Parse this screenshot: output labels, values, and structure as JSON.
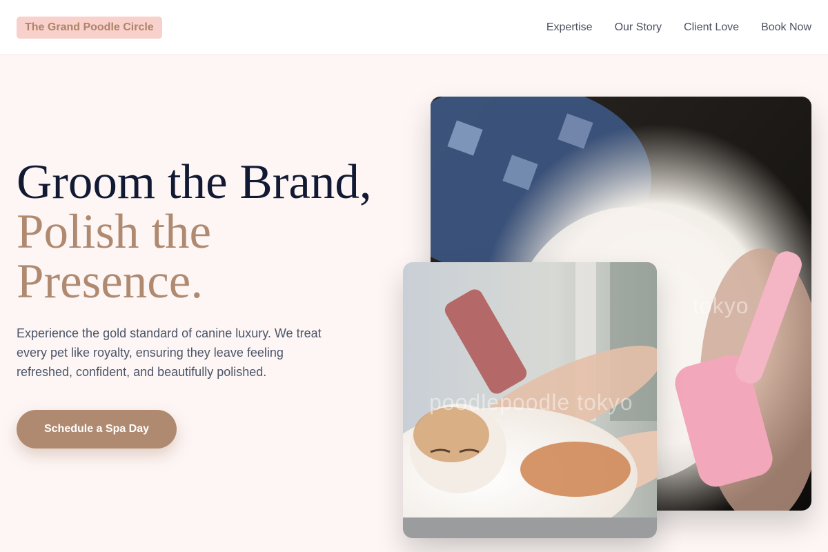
{
  "brand": {
    "logo_text": "The Grand Poodle Circle"
  },
  "nav": {
    "items": [
      {
        "label": "Expertise"
      },
      {
        "label": "Our Story"
      },
      {
        "label": "Client Love"
      },
      {
        "label": "Book Now"
      }
    ]
  },
  "hero": {
    "headline_line1": "Groom the Brand,",
    "headline_line2": "Polish the Presence.",
    "description": "Experience the gold standard of canine luxury. We treat every pet like royalty, ensuring they leave feeling refreshed, confident, and beautifully polished.",
    "cta_label": "Schedule a Spa Day"
  },
  "photos": {
    "main": {
      "watermark": "tokyo"
    },
    "small": {
      "watermark": "poodlepoodle tokyo"
    }
  },
  "colors": {
    "accent": "#b08a70",
    "logo_bg": "#f8d0cc",
    "headline_dark": "#121a33",
    "page_bg": "#fdf6f5"
  }
}
